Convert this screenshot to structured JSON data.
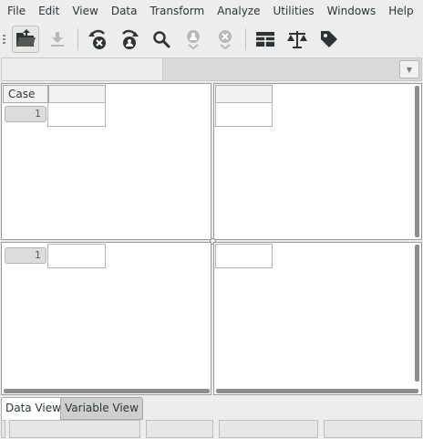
{
  "menubar": {
    "items": [
      "File",
      "Edit",
      "View",
      "Data",
      "Transform",
      "Analyze",
      "Utilities",
      "Windows",
      "Help"
    ]
  },
  "toolbar": {
    "buttons": [
      {
        "icon": "open-folder-icon",
        "enabled": true
      },
      {
        "icon": "save-icon",
        "enabled": false
      },
      {
        "icon": "undo-icon",
        "enabled": true
      },
      {
        "icon": "redo-icon",
        "enabled": true
      },
      {
        "icon": "find-icon",
        "enabled": true
      },
      {
        "icon": "insert-case-icon",
        "enabled": false
      },
      {
        "icon": "delete-case-icon",
        "enabled": false
      },
      {
        "icon": "split-view-icon",
        "enabled": true
      },
      {
        "icon": "weight-cases-icon",
        "enabled": true
      },
      {
        "icon": "value-labels-icon",
        "enabled": true
      }
    ]
  },
  "formula_bar": {
    "cell_ref": "",
    "value": "",
    "dropdown_glyph": "▼"
  },
  "grid": {
    "corner_label": "Case",
    "column_headers": [
      "",
      ""
    ],
    "top_row_number": "1",
    "bottom_row_number": "1"
  },
  "tabs": {
    "data_view": "Data View",
    "variable_view": "Variable View",
    "active": "data_view"
  },
  "colors": {
    "icon_dark": "#2e3436",
    "icon_disabled": "#b8b8b8",
    "window_bg": "#ededed"
  }
}
